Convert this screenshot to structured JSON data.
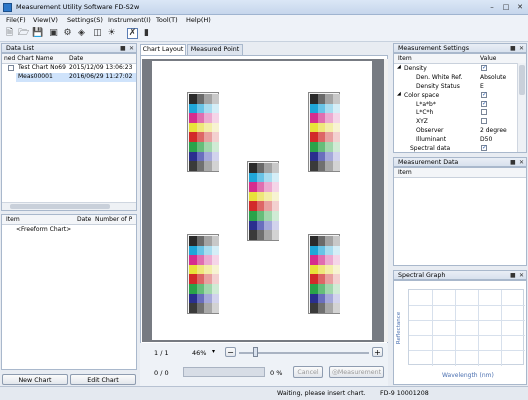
{
  "window": {
    "title": "Measurement Utility Software FD-S2w",
    "minimize": "–",
    "maximize": "□",
    "close": "✕"
  },
  "menu": [
    "File(F)",
    "View(V)",
    "Settings(S)",
    "Instrument(I)",
    "Tool(T)",
    "Help(H)"
  ],
  "toolbar": [
    "new-file-icon",
    "open-folder-icon",
    "save-icon",
    "camera-icon",
    "gear-icon",
    "calibration-icon",
    "measure-icon",
    "light-icon",
    "chart-layout-icon",
    "palette-icon"
  ],
  "data_list": {
    "header": "Data List",
    "columns": [
      "ned Chart Name",
      "Date"
    ],
    "rows": [
      {
        "name": "Test Chart No69",
        "date": "2015/12/09 13:06:23",
        "selected": false
      },
      {
        "name": "Meas00001",
        "date": "2016/06/29 11:27:02",
        "selected": true
      }
    ]
  },
  "chart_list": {
    "columns": [
      "Item",
      "Date",
      "Number of P"
    ],
    "rows": [
      "<Freeform Chart>"
    ]
  },
  "left_buttons": {
    "new_chart": "New Chart",
    "edit_chart": "Edit Chart"
  },
  "tabs": {
    "chart_layout": "Chart Layout",
    "measured_point": "Measured Point"
  },
  "chart_footer": {
    "page": "1 / 1",
    "zoom": "46%",
    "zoom_out": "−",
    "zoom_in": "+",
    "progress_count": "0 / 0",
    "progress_pct": "0 %",
    "progress_value": 0,
    "cancel": "Cancel",
    "measurement": "Measurement"
  },
  "measurement_settings": {
    "header": "Measurement Settings",
    "columns": [
      "Item",
      "Value"
    ],
    "rows": [
      {
        "label": "Density",
        "value": "",
        "check": true,
        "indent": 0,
        "expander": true
      },
      {
        "label": "Den. White Ref.",
        "value": "Absolute",
        "indent": 2
      },
      {
        "label": "Density Status",
        "value": "E",
        "indent": 2
      },
      {
        "label": "Color space",
        "value": "",
        "check": true,
        "indent": 0,
        "expander": true
      },
      {
        "label": "L*a*b*",
        "value": "",
        "check": true,
        "indent": 2
      },
      {
        "label": "L*C*h",
        "value": "",
        "check": false,
        "indent": 2
      },
      {
        "label": "XYZ",
        "value": "",
        "check": false,
        "indent": 2
      },
      {
        "label": "Observer",
        "value": "2 degree",
        "indent": 2
      },
      {
        "label": "Illuminant",
        "value": "D50",
        "indent": 2
      },
      {
        "label": "Spectral data",
        "value": "",
        "check": true,
        "indent": 1
      }
    ]
  },
  "measurement_data": {
    "header": "Measurement Data",
    "column": "Item"
  },
  "spectral_graph": {
    "header": "Spectral Graph",
    "ylabel": "Reflectance",
    "xlabel": "Wavelength (nm)"
  },
  "status": {
    "message": "Waiting, please insert chart.",
    "device": "FD-9 10001208"
  },
  "colors": {
    "patch_rows": [
      [
        "#2a2a2a",
        "#6a6a6a",
        "#a3a3a3",
        "#c8c8c8"
      ],
      [
        "#1fa6d8",
        "#68c3e6",
        "#a8dcef",
        "#d5eef7"
      ],
      [
        "#d62d8e",
        "#e06eb0",
        "#ecaad1",
        "#f5d5e8"
      ],
      [
        "#e8e23a",
        "#eee77a",
        "#f3eea8",
        "#f7f3d2"
      ],
      [
        "#d22a2a",
        "#dd6666",
        "#e8a0a0",
        "#f3d0d0"
      ],
      [
        "#2aa34a",
        "#66bd7a",
        "#a1d7ac",
        "#d0ebd5"
      ],
      [
        "#2a2f8e",
        "#6a6ebd",
        "#a5a8da",
        "#d2d3ed"
      ],
      [
        "#3a3a3a",
        "#707070",
        "#a8a8a8",
        "#d3d3d3"
      ]
    ]
  }
}
